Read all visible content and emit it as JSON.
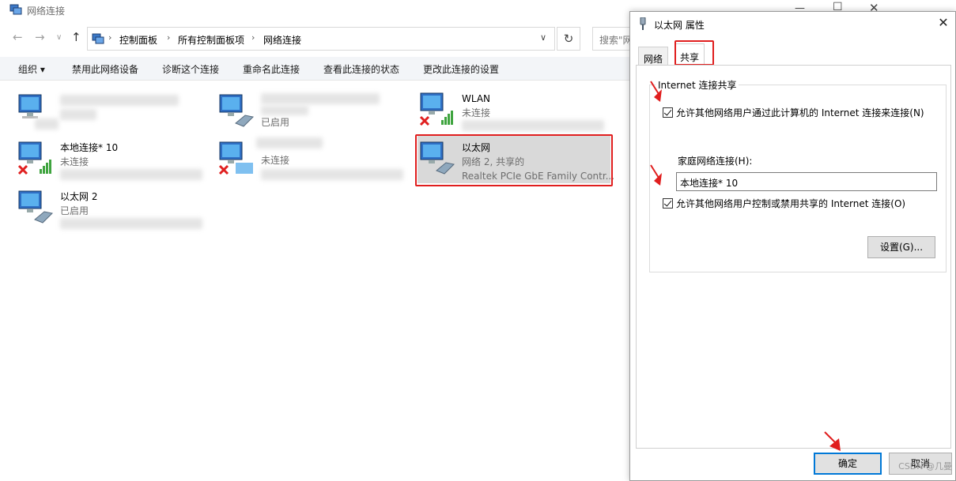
{
  "explorer": {
    "title": "网络连接",
    "breadcrumb": [
      "控制面板",
      "所有控制面板项",
      "网络连接"
    ],
    "search_placeholder": "搜索\"网",
    "toolbar": {
      "organize": "组织 ▾",
      "disable": "禁用此网络设备",
      "diagnose": "诊断这个连接",
      "rename": "重命名此连接",
      "view_status": "查看此连接的状态",
      "change_settings": "更改此连接的设置"
    },
    "connections": [
      {
        "name": "",
        "status": "",
        "device": ""
      },
      {
        "name": "",
        "status": "已启用",
        "device": ""
      },
      {
        "name": "WLAN",
        "status": "未连接",
        "device": ""
      },
      {
        "name": "本地连接* 10",
        "status": "未连接",
        "device": ""
      },
      {
        "name": "",
        "status": "未连接",
        "device": ""
      },
      {
        "name": "以太网",
        "status": "网络 2, 共享的",
        "device": "Realtek PCIe GbE Family Contr..."
      },
      {
        "name": "以太网 2",
        "status": "已启用",
        "device": ""
      }
    ]
  },
  "dialog": {
    "title": "以太网 属性",
    "tabs": [
      "网络",
      "共享"
    ],
    "active_tab": "共享",
    "group_title": "Internet 连接共享",
    "allow_share_label": "允许其他网络用户通过此计算机的 Internet 连接来连接(N)",
    "allow_share_checked": true,
    "home_network_label": "家庭网络连接(H):",
    "home_network_value": "本地连接* 10",
    "allow_control_label": "允许其他网络用户控制或禁用共享的 Internet 连接(O)",
    "allow_control_checked": true,
    "settings_button": "设置(G)...",
    "ok_button": "确定",
    "cancel_button": "取消"
  },
  "watermark": "CSDN @几曼",
  "colors": {
    "highlight_red": "#e01e1e",
    "selection_grey": "#d9d9d9",
    "default_button_blue": "#0078d7"
  }
}
